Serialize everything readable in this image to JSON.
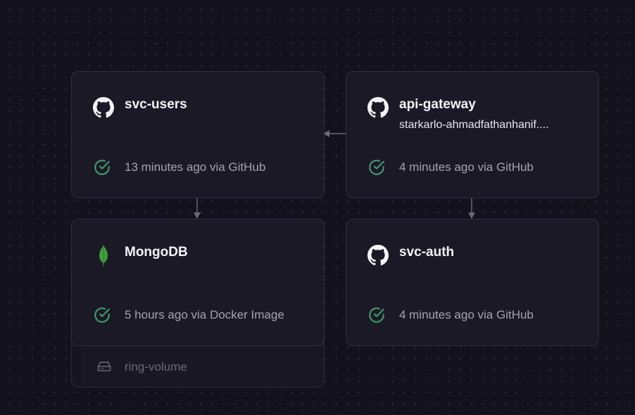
{
  "colors": {
    "background": "#13111c",
    "card": "#1b1926",
    "border": "#332f42",
    "success": "#3f9b6c",
    "muted_text": "#a5a2b4",
    "connector": "#6c6878",
    "mongodb_leaf": "#3f9e3c"
  },
  "services": [
    {
      "icon": "github-icon",
      "name": "svc-users",
      "subtitle": "",
      "status_icon": "check-circle-icon",
      "status": "13 minutes ago via GitHub"
    },
    {
      "icon": "github-icon",
      "name": "api-gateway",
      "subtitle": "starkarlo-ahmadfathanhanif....",
      "status_icon": "check-circle-icon",
      "status": "4 minutes ago via GitHub"
    },
    {
      "icon": "mongodb-leaf-icon",
      "name": "MongoDB",
      "subtitle": "",
      "status_icon": "check-circle-icon",
      "status": "5 hours ago via Docker Image"
    },
    {
      "icon": "github-icon",
      "name": "svc-auth",
      "subtitle": "",
      "status_icon": "check-circle-icon",
      "status": "4 minutes ago via GitHub"
    }
  ],
  "volume": {
    "icon": "hard-drive-icon",
    "label": "ring-volume"
  }
}
